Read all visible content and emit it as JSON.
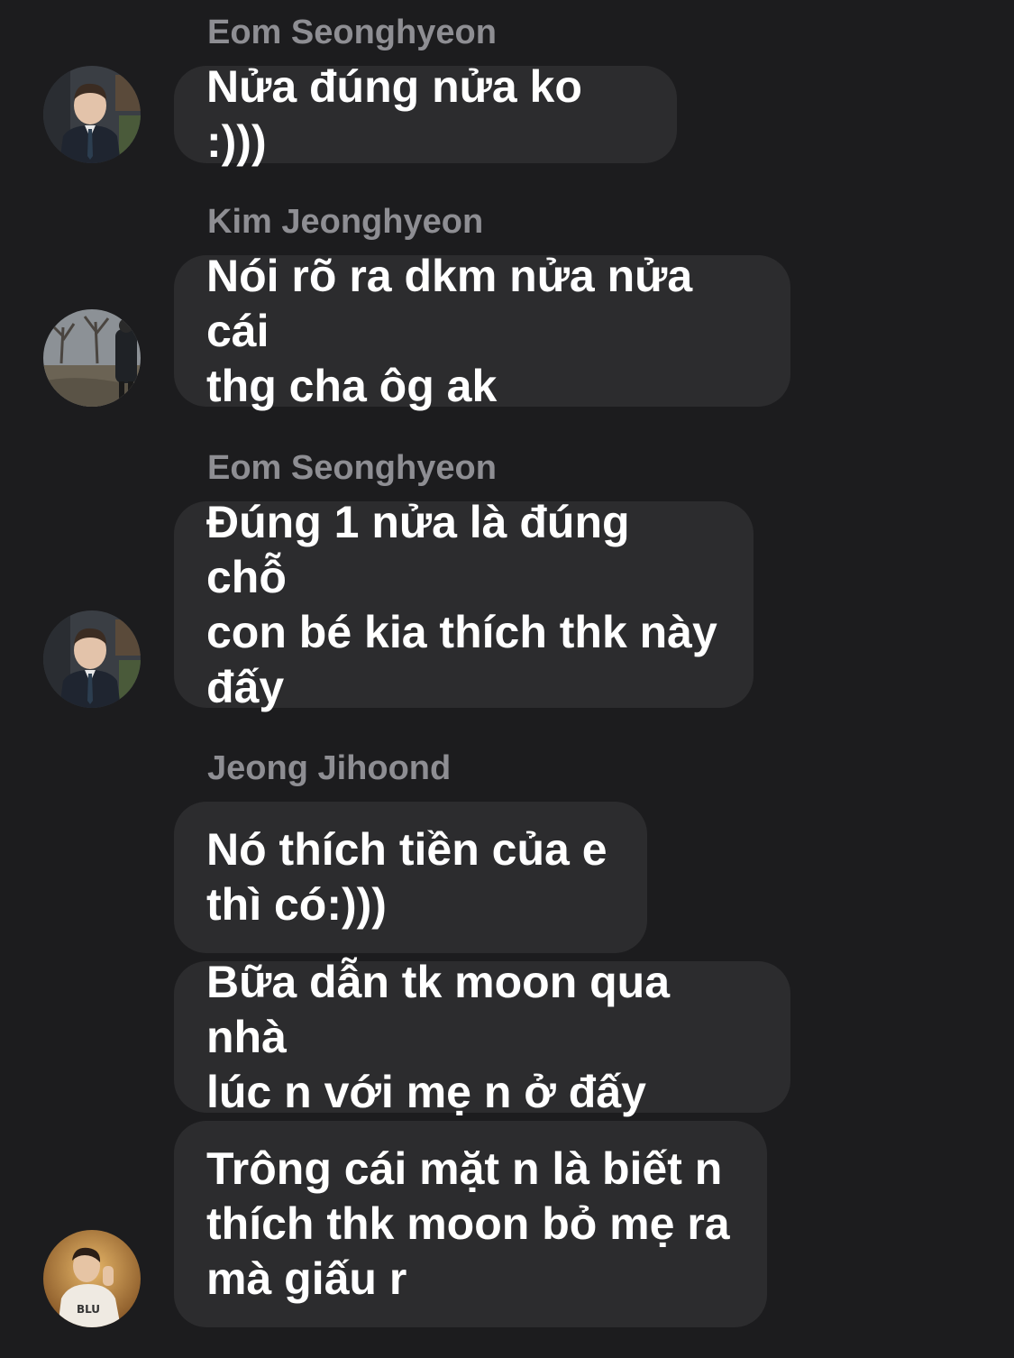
{
  "messages": [
    {
      "sender": "Eom Seonghyeon",
      "text": "Nửa đúng nửa ko :)))"
    },
    {
      "sender": "Kim Jeonghyeon",
      "text": "Nói rõ ra dkm nửa nửa cái\nthg cha ôg ak"
    },
    {
      "sender": "Eom Seonghyeon",
      "text": "Đúng 1 nửa là đúng chỗ\ncon bé kia thích thk này\nđấy"
    },
    {
      "sender": "Jeong Jihoond",
      "text": "Nó thích tiền của e\nthì có:)))"
    },
    {
      "text": "Bữa dẫn tk moon qua nhà\nlúc n với mẹ n ở đấy"
    },
    {
      "text": "Trông cái mặt n là biết n\nthích thk moon bỏ mẹ ra\nmà giấu r"
    }
  ],
  "avatars": [
    {
      "icon": "suit-portrait-avatar"
    },
    {
      "icon": "park-photo-avatar"
    },
    {
      "icon": "suit-portrait-avatar"
    },
    {
      "icon": "warm-portrait-avatar"
    }
  ],
  "colors": {
    "background": "#1c1c1e",
    "bubble": "#2c2c2e",
    "sender_name": "#8e8e93",
    "message_text": "#ffffff"
  }
}
